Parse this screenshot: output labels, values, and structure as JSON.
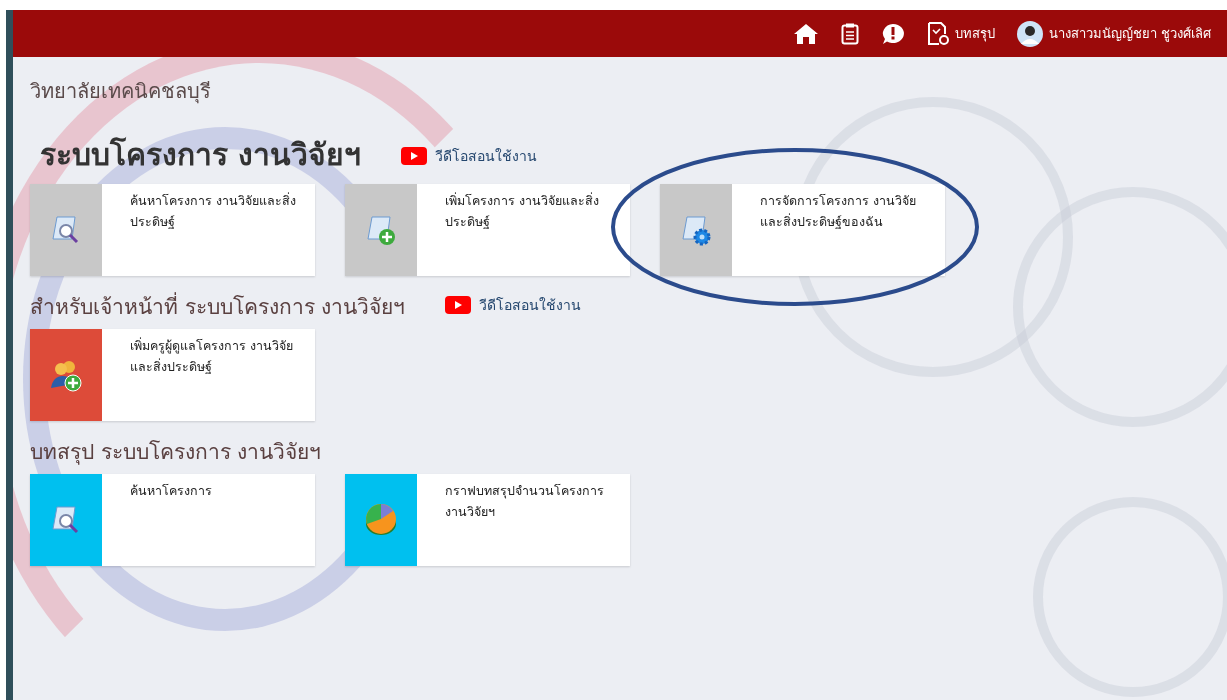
{
  "topbar": {
    "nav": [
      {
        "kind": "home"
      },
      {
        "kind": "clipboard"
      },
      {
        "kind": "alert"
      },
      {
        "kind": "summary",
        "label": "บทสรุป"
      }
    ],
    "user": {
      "name": "นางสาวมนัญญ์ชยา ชูวงศ์เลิศ"
    }
  },
  "college": "วิทยาลัยเทคนิคชลบุรี",
  "sections": [
    {
      "title": "ระบบโครงการ งานวิจัยฯ",
      "main": true,
      "video": "วีดีโอสอนใช้งาน",
      "tiles": [
        {
          "label": "ค้นหาโครงการ งานวิจัยและสิ่งประดิษฐ์",
          "kind": "search",
          "color": "#c8c8c8",
          "circled": false
        },
        {
          "label": "เพิ่มโครงการ งานวิจัยและสิ่งประดิษฐ์",
          "kind": "add",
          "color": "#c8c8c8",
          "circled": false
        },
        {
          "label": "การจัดการโครงการ งานวิจัยและสิ่งประดิษฐ์ของฉัน",
          "kind": "manage",
          "color": "#c8c8c8",
          "circled": true
        }
      ]
    },
    {
      "title": "สำหรับเจ้าหน้าที่ ระบบโครงการ งานวิจัยฯ",
      "main": false,
      "video": "วีดีโอสอนใช้งาน",
      "tiles": [
        {
          "label": "เพิ่มครูผู้ดูแลโครงการ งานวิจัยและสิ่งประดิษฐ์",
          "kind": "users",
          "color": "#dd4b39",
          "circled": false
        }
      ]
    },
    {
      "title": "บทสรุป ระบบโครงการ งานวิจัยฯ",
      "main": false,
      "tiles": [
        {
          "label": "ค้นหาโครงการ",
          "kind": "search",
          "color": "#00c0ef",
          "circled": false
        },
        {
          "label": "กราฟบทสรุปจำนวนโครงการ งานวิจัยฯ",
          "kind": "pie",
          "color": "#00c0ef",
          "circled": false
        }
      ]
    }
  ]
}
